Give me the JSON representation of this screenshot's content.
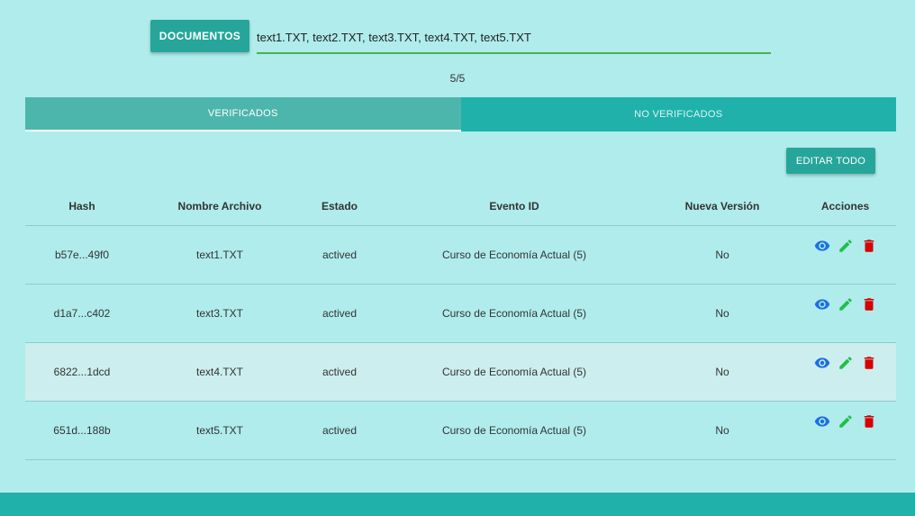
{
  "upload": {
    "button_label": "DOCUMENTOS",
    "file_names": "text1.TXT, text2.TXT, text3.TXT, text4.TXT, text5.TXT",
    "count": "5/5"
  },
  "tabs": [
    {
      "label": "VERIFICADOS",
      "active": true
    },
    {
      "label": "NO VERIFICADOS",
      "active": false
    }
  ],
  "edit_all_label": "EDITAR TODO",
  "table": {
    "headers": [
      "Hash",
      "Nombre Archivo",
      "Estado",
      "Evento ID",
      "Nueva Versión",
      "Acciones"
    ],
    "rows": [
      {
        "hash": "b57e...49f0",
        "file": "text1.TXT",
        "status": "actived",
        "event": "Curso de Economía Actual (5)",
        "new_version": "No"
      },
      {
        "hash": "d1a7...c402",
        "file": "text3.TXT",
        "status": "actived",
        "event": "Curso de Economía Actual (5)",
        "new_version": "No"
      },
      {
        "hash": "6822...1dcd",
        "file": "text4.TXT",
        "status": "actived",
        "event": "Curso de Economía Actual (5)",
        "new_version": "No"
      },
      {
        "hash": "651d...188b",
        "file": "text5.TXT",
        "status": "actived",
        "event": "Curso de Economía Actual (5)",
        "new_version": "No"
      }
    ]
  },
  "icons": {
    "view": "eye-icon",
    "edit": "pencil-icon",
    "delete": "trash-icon"
  },
  "colors": {
    "background": "#b0ecec",
    "primary": "#26a69a",
    "tab_bar": "#20b2aa",
    "view_icon": "#1e6fe0",
    "edit_icon": "#1fbf4a",
    "delete_icon": "#d50000"
  }
}
